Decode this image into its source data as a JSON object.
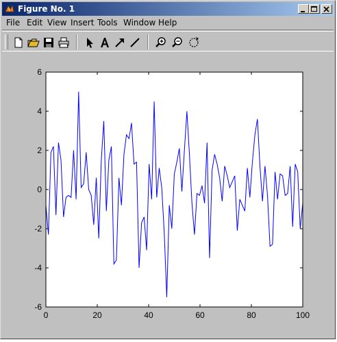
{
  "window": {
    "title": "Figure No. 1",
    "icon": "matlab-logo-icon"
  },
  "menu": [
    "File",
    "Edit",
    "View",
    "Insert",
    "Tools",
    "Window",
    "Help"
  ],
  "toolbar": {
    "buttons": [
      "new-file-icon",
      "open-folder-icon",
      "save-icon",
      "print-icon",
      "select-arrow-icon",
      "text-icon",
      "arrow-icon",
      "line-icon",
      "zoom-in-icon",
      "zoom-out-icon",
      "rotate-icon"
    ]
  },
  "colors": {
    "line": "#0000ff",
    "axes_bg": "#ffffff",
    "figure_bg": "#c0c0c0",
    "titlebar": "#0a246a"
  },
  "chart_data": {
    "type": "line",
    "xlim": [
      0,
      100
    ],
    "ylim": [
      -6,
      6
    ],
    "xticks": [
      "0",
      "20",
      "40",
      "60",
      "80",
      "100"
    ],
    "yticks": [
      "6",
      "4",
      "2",
      "0",
      "-2",
      "-4",
      "-6"
    ],
    "series": [
      {
        "values": [
          -0.8,
          -2.3,
          1.9,
          2.2,
          -1.3,
          2.4,
          1.5,
          -1.4,
          -0.4,
          -0.3,
          -0.4,
          2.0,
          -0.5,
          5.0,
          0.1,
          0.3,
          1.9,
          0.0,
          -0.3,
          -1.8,
          0.6,
          -2.5,
          1.5,
          3.5,
          -1.1,
          1.5,
          2.2,
          -3.8,
          -3.6,
          0.6,
          -0.8,
          1.8,
          2.8,
          2.6,
          3.4,
          1.3,
          1.4,
          -4.0,
          -1.7,
          -1.4,
          -3.1,
          1.3,
          -0.5,
          4.5,
          -0.4,
          1.1,
          0.1,
          -2.2,
          -5.5,
          -0.8,
          -2.0,
          0.8,
          1.4,
          2.1,
          -0.1,
          2.0,
          4.0,
          1.8,
          -0.7,
          -2.3,
          -0.2,
          -0.3,
          0.2,
          -0.7,
          2.4,
          -3.5,
          1.0,
          1.8,
          1.3,
          0.6,
          -0.6,
          1.2,
          0.7,
          0.1,
          0.4,
          0.7,
          -2.1,
          -0.5,
          -0.8,
          -1.1,
          1.1,
          -0.4,
          1.4,
          2.8,
          3.6,
          1.2,
          -0.6,
          1.2,
          -0.3,
          -2.9,
          -2.8,
          0.9,
          -0.5,
          0.8,
          0.7,
          -0.3,
          -0.2,
          1.2,
          -1.9,
          1.3,
          0.9,
          -2.0,
          -0.7
        ]
      }
    ]
  }
}
